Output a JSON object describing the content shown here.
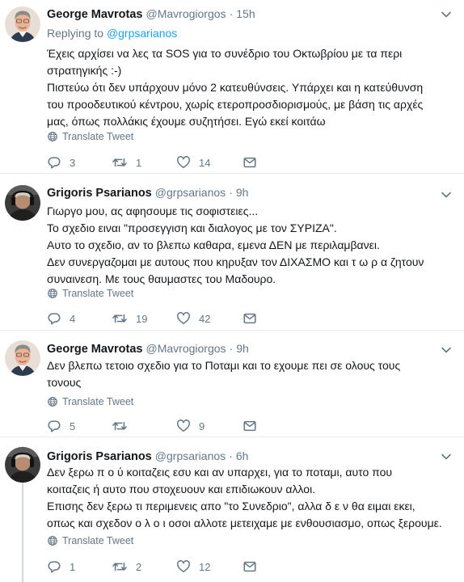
{
  "ui": {
    "translate_label": "Translate Tweet",
    "replying_prefix": "Replying to",
    "dot": "·"
  },
  "colors": {
    "link": "#1da1f2",
    "muted": "#657786",
    "divider": "#e6ecf0",
    "thread_line": "#cfd9de"
  },
  "icons": [
    "chevron-down-icon",
    "translate-globe-icon",
    "reply-icon",
    "retweet-icon",
    "like-icon",
    "dm-envelope-icon"
  ],
  "tweets": [
    {
      "name": "George Mavrotas",
      "handle": "@Mavrogiorgos",
      "time": "15h",
      "replying_to": "@grpsarianos",
      "lines": [
        "Έχεις αρχίσει να λες τα SOS για το συνέδριο του Οκτωβρίου με τα περι",
        "στρατηγικής :-)",
        "Πιστεύω ότι δεν υπάρχουν μόνο 2 κατευθύνσεις. Υπάρχει και η κατεύθυνση",
        "του προοδευτικού κέντρου, χωρίς ετεροπροσδιορισμούς, με βάση τις αρχές",
        "μας, όπως πολλάκις έχουμε συζητήσει. Εγώ εκεί κοιτάω"
      ],
      "replies": "3",
      "retweets": "1",
      "likes": "14"
    },
    {
      "name": "Grigoris Psarianos",
      "handle": "@grpsarianos",
      "time": "9h",
      "lines": [
        "Γιωργο μου,  ας αφησουμε τις σοφιστειες...",
        "Το σχεδιο ειναι \"προσεγγιση και διαλογος με τον ΣΥΡΙΖΑ\".",
        "Αυτο το σχεδιο, αν το βλεπω καθαρα, εμενα ΔΕΝ με περιλαμβανει.",
        "Δεν συνεργαζομαι με αυτους που κηρυξαν τον ΔΙΧΑΣΜΟ και τ ω ρ α ζητουν",
        "συναινεση. Με τους θαυμαστες του Μαδουρο."
      ],
      "replies": "4",
      "retweets": "19",
      "likes": "42"
    },
    {
      "name": "George Mavrotas",
      "handle": "@Mavrogiorgos",
      "time": "9h",
      "lines": [
        "Δεν βλεπω τετοιο σχεδιο για το Ποταμι και το εχουμε πει σε ολους τους",
        "τονους"
      ],
      "replies": "5",
      "retweets": "",
      "likes": "9"
    },
    {
      "name": "Grigoris Psarianos",
      "handle": "@grpsarianos",
      "time": "6h",
      "lines": [
        "Δεν ξερω π ο ύ κοιταζεις εσυ και αν υπαρχει, για το ποταμι, αυτο που",
        "κοιταζεις ή αυτο που στοχευουν και επιδιωκουν αλλοι.",
        "Επισης δεν ξερω τι περιμενεις απο \"το Συνεδριο\", αλλα  δ ε ν  θα ειμαι εκει,",
        "οπως και σχεδον ο λ ο ι οσοι αλλοτε μετειχαμε με ενθουσιασμο, οπως ξερουμε."
      ],
      "replies": "1",
      "retweets": "2",
      "likes": "12"
    }
  ]
}
